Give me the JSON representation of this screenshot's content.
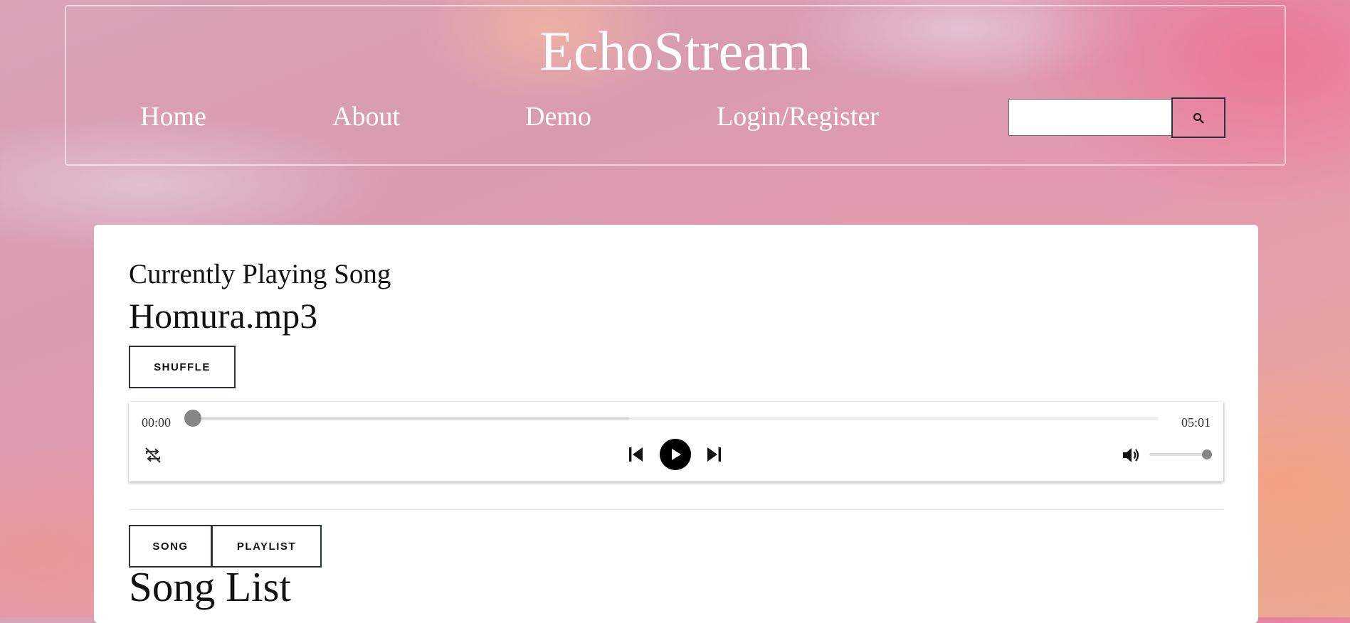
{
  "header": {
    "brand": "EchoStream",
    "nav": [
      {
        "label": "Home"
      },
      {
        "label": "About"
      },
      {
        "label": "Demo"
      },
      {
        "label": "Login/Register"
      }
    ],
    "search": {
      "value": "",
      "placeholder": "",
      "icon": "search-icon"
    }
  },
  "player_section": {
    "subtitle": "Currently Playing Song",
    "song_title": "Homura.mp3",
    "shuffle_label": "SHUFFLE",
    "player": {
      "current_time": "00:00",
      "duration": "05:01",
      "progress_fraction": 0,
      "buffered_fraction": 0.45,
      "volume_fraction": 1,
      "icons": {
        "repeat": "repeat-off-icon",
        "previous": "skip-previous-icon",
        "play": "play-icon",
        "next": "skip-next-icon",
        "volume": "volume-icon"
      }
    }
  },
  "list_section": {
    "tabs": [
      {
        "label": "SONG"
      },
      {
        "label": "PLAYLIST"
      }
    ],
    "title": "Song List"
  }
}
